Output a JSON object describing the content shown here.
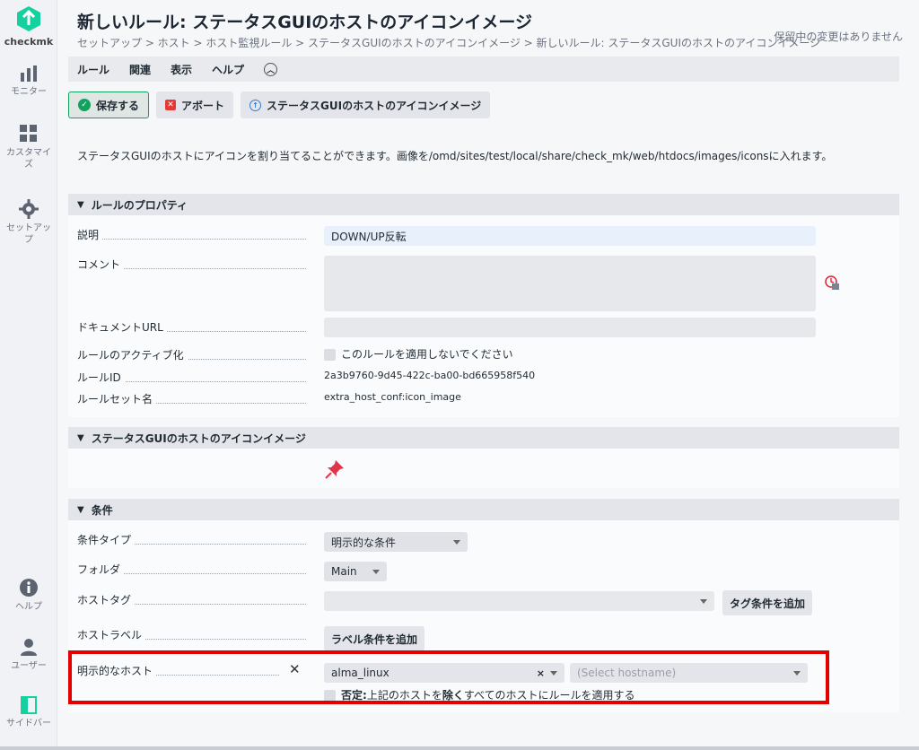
{
  "sidebar": {
    "logo": "checkmk",
    "items": [
      {
        "label": "モニター",
        "icon": "bar-chart-icon"
      },
      {
        "label": "カスタマイズ",
        "icon": "grid-icon"
      },
      {
        "label": "セットアップ",
        "icon": "gear-icon"
      }
    ],
    "bottom": [
      {
        "label": "ヘルプ",
        "icon": "info-icon"
      },
      {
        "label": "ユーザー",
        "icon": "user-icon"
      },
      {
        "label": "サイドバー",
        "icon": "sidebar-icon"
      }
    ],
    "accent": "#15d1a0"
  },
  "header": {
    "title": "新しいルール: ステータスGUIのホストのアイコンイメージ",
    "breadcrumb": "セットアップ > ホスト > ホスト監視ルール > ステータスGUIのホストのアイコンイメージ > 新しいルール: ステータスGUIのホストのアイコンイメージ",
    "pending": "保留中の変更はありません"
  },
  "menu": [
    "ルール",
    "関連",
    "表示",
    "ヘルプ"
  ],
  "toolbar": {
    "save": "保存する",
    "abort": "アボート",
    "info": "ステータスGUIのホストのアイコンイメージ"
  },
  "intro": "ステータスGUIのホストにアイコンを割り当てることができます。画像を/omd/sites/test/local/share/check_mk/web/htdocs/images/iconsに入れます。",
  "properties": {
    "header": "ルールのプロパティ",
    "description_label": "説明",
    "description_value": "DOWN/UP反転",
    "comment_label": "コメント",
    "doc_url_label": "ドキュメントURL",
    "activation_label": "ルールのアクティブ化",
    "activation_checkbox": "このルールを適用しないでください",
    "rule_id_label": "ルールID",
    "rule_id_value": "2a3b9760-9d45-422c-ba00-bd665958f540",
    "ruleset_label": "ルールセット名",
    "ruleset_value": "extra_host_conf:icon_image"
  },
  "icon_section": {
    "header": "ステータスGUIのホストのアイコンイメージ"
  },
  "conditions": {
    "header": "条件",
    "type_label": "条件タイプ",
    "type_value": "明示的な条件",
    "folder_label": "フォルダ",
    "folder_value": "Main",
    "hosttag_label": "ホストタグ",
    "hosttag_button": "タグ条件を追加",
    "hostlabel_label": "ホストラベル",
    "hostlabel_button": "ラベル条件を追加",
    "explicit_label": "明示的なホスト",
    "explicit_value": "alma_linux",
    "explicit_placeholder": "(Select hostname)",
    "negate_prefix": "否定:",
    "negate_text_1": "上記のホストを",
    "negate_bold": "除く",
    "negate_text_2": "すべてのホストにルールを適用する"
  }
}
